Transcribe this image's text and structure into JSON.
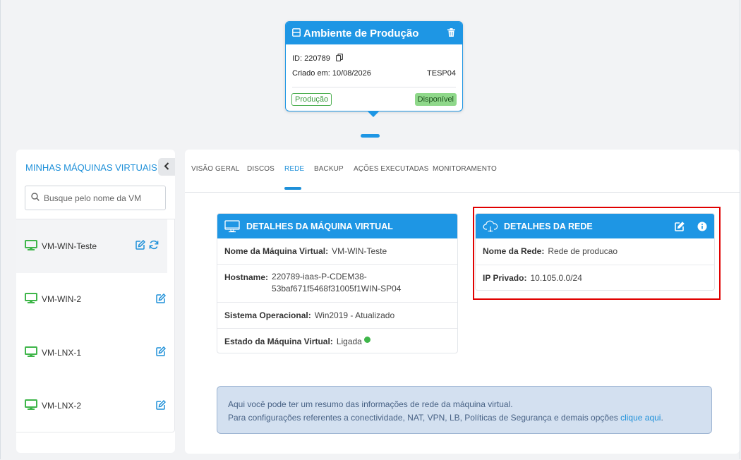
{
  "environment": {
    "title": "Ambiente de Produção",
    "id_text": "ID: 220789",
    "created_text": "Criado em: 10/08/2026",
    "code": "TESP04",
    "tag_env": "Produção",
    "tag_status": "Disponível"
  },
  "sidebar": {
    "title": "MINHAS MÁQUINAS VIRTUAIS",
    "search_placeholder": "Busque pelo nome da VM",
    "vms": [
      {
        "name": "VM-WIN-Teste"
      },
      {
        "name": "VM-WIN-2"
      },
      {
        "name": "VM-LNX-1"
      },
      {
        "name": "VM-LNX-2"
      }
    ]
  },
  "tabs": [
    {
      "label": "VISÃO GERAL"
    },
    {
      "label": "DISCOS"
    },
    {
      "label": "REDE"
    },
    {
      "label": "BACKUP"
    },
    {
      "label": "AÇÕES EXECUTADAS"
    },
    {
      "label": "MONITORAMENTO"
    }
  ],
  "vm_details": {
    "title": "DETALHES DA MÁQUINA VIRTUAL",
    "rows": [
      {
        "label": "Nome da Máquina Virtual:",
        "value": "VM-WIN-Teste"
      },
      {
        "label": "Hostname:",
        "value_line1": "220789-iaas-P-CDEM38-",
        "value_line2": "53baf671f5468f31005f1WIN-SP04"
      },
      {
        "label": "Sistema Operacional:",
        "value": "Win2019 - Atualizado"
      },
      {
        "label": "Estado da Máquina Virtual:",
        "value": "Ligada"
      }
    ]
  },
  "network_details": {
    "title": "DETALHES DA REDE",
    "rows": [
      {
        "label": "Nome da Rede:",
        "value": "Rede de producao"
      },
      {
        "label": "IP Privado:",
        "value": "10.105.0.0/24"
      }
    ]
  },
  "info": {
    "line1": "Aqui você pode ter um resumo das informações de rede da máquina virtual.",
    "line2": "Para configurações referentes a conectividade, NAT, VPN, LB, Políticas de Segurança e demais opções",
    "link": "clique aqui",
    "suffix": "."
  },
  "colors": {
    "primary": "#1e96e4",
    "vm_icon": "#3fb64a",
    "highlight": "#e00000"
  }
}
